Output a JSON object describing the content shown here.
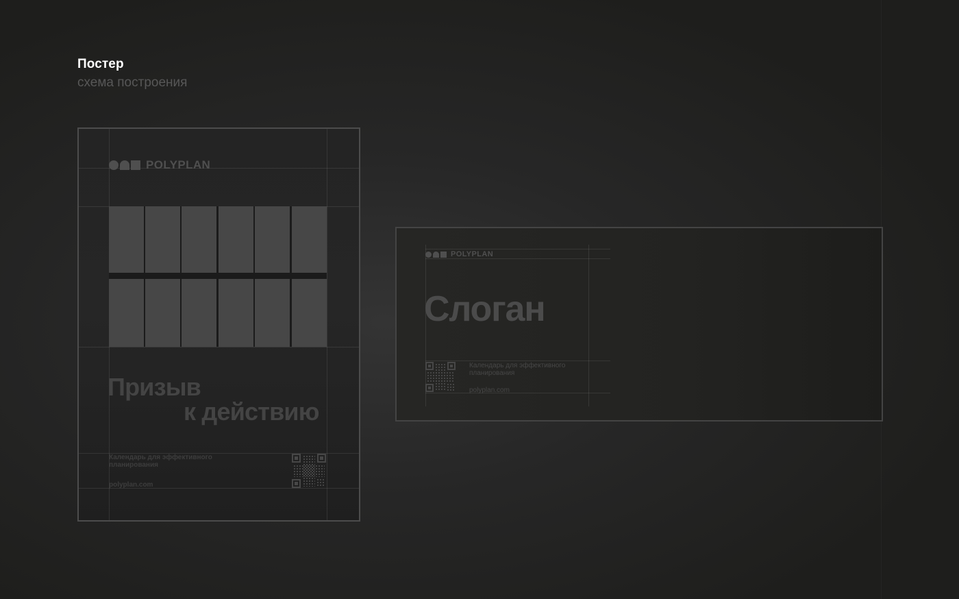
{
  "header": {
    "title": "Постер",
    "subtitle": "схема построения"
  },
  "poster": {
    "logo_text": "POLYPLAN",
    "cta_line1": "Призыв",
    "cta_line2": "к действию",
    "tagline_line1": "Календарь для эффективного",
    "tagline_line2": "планирования",
    "url": "polyplan.com"
  },
  "banner": {
    "logo_text": "POLYPLAN",
    "slogan": "Слоган",
    "tagline_line1": "Календарь для эффективного",
    "tagline_line2": "планирования",
    "url": "polyplan.com"
  },
  "colors": {
    "background": "#222222",
    "frame": "#4c4c4c",
    "placeholder": "#474747",
    "title": "#ffffff",
    "subtitle": "#575757"
  },
  "icons": [
    "polyplan-logo-icon",
    "qr-code-icon"
  ]
}
